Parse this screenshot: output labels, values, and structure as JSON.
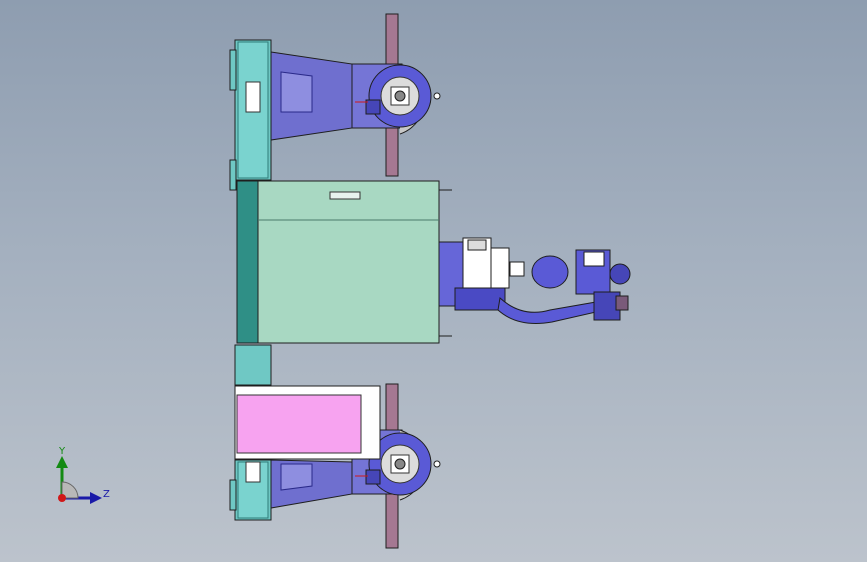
{
  "viewport": {
    "background_top": "#8e9db0",
    "background_bottom": "#bcc3cc"
  },
  "colors": {
    "frame_cyan": "#6fc8c4",
    "bracket_blue": "#6f6fcf",
    "post_mauve": "#a57892",
    "cabinet_green": "#a8d8c2",
    "cabinet_side": "#2f8f86",
    "panel_pink": "#f7a3f0",
    "robot_blue": "#5a5ad6",
    "disc_grey": "#c8c8c8",
    "outline": "#1e1e1e"
  },
  "triad": {
    "y_label": "Y",
    "z_label": "Z",
    "y_color": "#138a13",
    "z_color": "#1a1aa8",
    "origin_color": "#d01818"
  },
  "components": [
    {
      "name": "base-frame",
      "icon": "frame-icon"
    },
    {
      "name": "upper-positioner",
      "icon": "positioner-icon"
    },
    {
      "name": "lower-positioner",
      "icon": "positioner-icon"
    },
    {
      "name": "control-cabinet",
      "icon": "cabinet-icon"
    },
    {
      "name": "fixture-panel",
      "icon": "panel-icon"
    },
    {
      "name": "robot-arm",
      "icon": "robot-arm-icon"
    }
  ]
}
